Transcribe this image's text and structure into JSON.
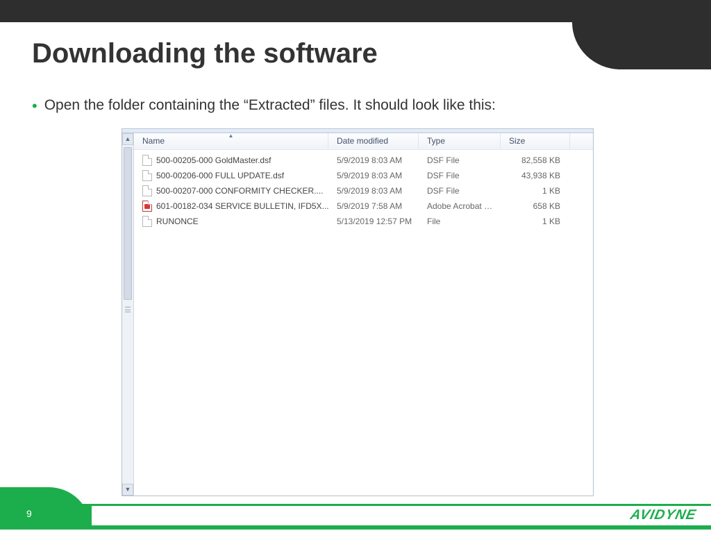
{
  "slide": {
    "title": "Downloading the software",
    "bullet": "Open the folder containing the “Extracted” files.  It should look like this:",
    "page_number": "9"
  },
  "brand": "AVIDYNE",
  "explorer": {
    "columns": {
      "name": "Name",
      "date": "Date modified",
      "type": "Type",
      "size": "Size"
    },
    "rows": [
      {
        "icon": "file",
        "name": "500-00205-000 GoldMaster.dsf",
        "date": "5/9/2019 8:03 AM",
        "type": "DSF File",
        "size": "82,558 KB"
      },
      {
        "icon": "file",
        "name": "500-00206-000 FULL UPDATE.dsf",
        "date": "5/9/2019 8:03 AM",
        "type": "DSF File",
        "size": "43,938 KB"
      },
      {
        "icon": "file",
        "name": "500-00207-000 CONFORMITY CHECKER....",
        "date": "5/9/2019 8:03 AM",
        "type": "DSF File",
        "size": "1 KB"
      },
      {
        "icon": "pdf",
        "name": "601-00182-034 SERVICE BULLETIN, IFD5X...",
        "date": "5/9/2019 7:58 AM",
        "type": "Adobe Acrobat D...",
        "size": "658 KB"
      },
      {
        "icon": "file",
        "name": "RUNONCE",
        "date": "5/13/2019 12:57 PM",
        "type": "File",
        "size": "1 KB"
      }
    ]
  }
}
